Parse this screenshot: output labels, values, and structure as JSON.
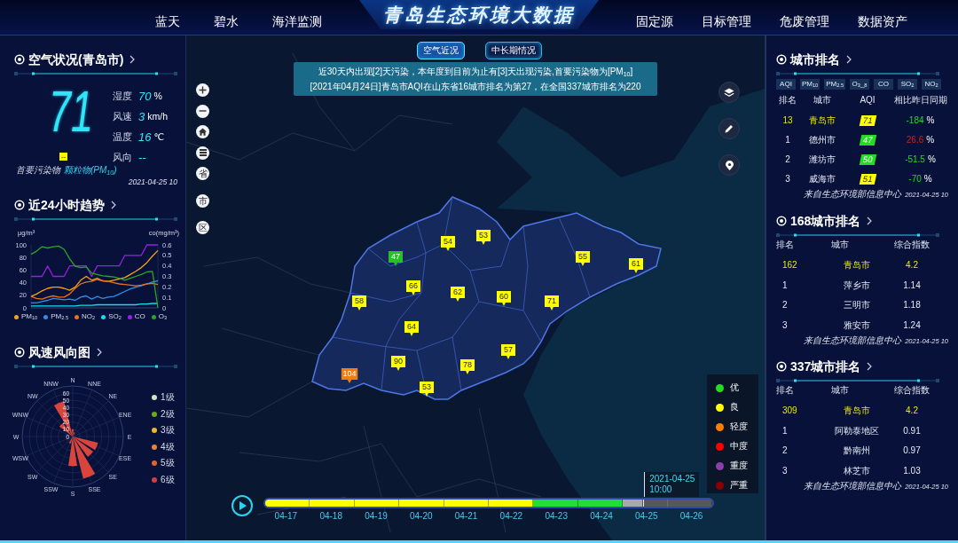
{
  "header": {
    "nav_left": [
      "蓝天",
      "碧水",
      "海洋监测"
    ],
    "title": "青岛生态环境大数据",
    "nav_right": [
      "固定源",
      "目标管理",
      "危废管理",
      "数据资产"
    ]
  },
  "air_status": {
    "title": "空气状况(青岛市)",
    "aqi": "71",
    "weather": [
      {
        "label": "湿度",
        "value": "70",
        "unit": "%"
      },
      {
        "label": "风速",
        "value": "3",
        "unit": "km/h"
      },
      {
        "label": "温度",
        "value": "16",
        "unit": "℃"
      }
    ],
    "wind_direction": {
      "label": "风向",
      "value": "--"
    },
    "pollutant_badge": "--",
    "pollutant_label": "首要污染物",
    "pollutant_value": "颗粒物(PM$_{10}$)",
    "time": "2021-04-25 10"
  },
  "trend": {
    "title": "近24小时趋势",
    "chart_data": {
      "type": "line",
      "ylabel": "μg/m³",
      "ylim": [
        0,
        100
      ],
      "yticks": [
        0,
        20,
        40,
        60,
        80,
        100
      ],
      "y2label": "co(mg/m³)",
      "y2lim": [
        0,
        0.6
      ],
      "y2ticks": [
        0,
        0.1,
        0.2,
        0.3,
        0.4,
        0.5,
        0.6
      ],
      "series": [
        {
          "name": "PM$_{10}$",
          "color": "#f2a51a",
          "values": [
            18,
            22,
            27,
            31,
            33,
            33,
            31,
            28,
            33,
            44,
            50,
            44,
            47,
            43,
            42,
            44,
            46,
            48,
            53,
            58,
            64,
            72,
            82,
            91
          ]
        },
        {
          "name": "PM$_{2.5}$",
          "color": "#2f8fe6",
          "values": [
            8,
            8,
            10,
            12,
            15,
            14,
            13,
            14,
            12,
            17,
            19,
            14,
            18,
            15,
            17,
            18,
            22,
            26,
            30,
            33,
            35,
            38,
            41,
            43
          ]
        },
        {
          "name": "NO$_{2}$",
          "color": "#e8711c",
          "values": [
            18,
            15,
            14,
            17,
            19,
            17,
            17,
            22,
            31,
            38,
            41,
            42,
            45,
            43,
            42,
            40,
            38,
            37,
            36,
            35,
            36,
            38,
            39,
            37
          ]
        },
        {
          "name": "SO$_{2}$",
          "color": "#10e0f0",
          "values": [
            3,
            3,
            3,
            3,
            3,
            3,
            3,
            3,
            3,
            4,
            4,
            4,
            5,
            5,
            5,
            5,
            5,
            5,
            5,
            5,
            6,
            6,
            7,
            7
          ]
        },
        {
          "name": "CO",
          "color": "#9b1de8",
          "axis": "y2",
          "values": [
            0.3,
            0.3,
            0.3,
            0.4,
            0.3,
            0.3,
            0.3,
            0.4,
            0.4,
            0.4,
            0.4,
            0.3,
            0.4,
            0.4,
            0.4,
            0.4,
            0.4,
            0.5,
            0.5,
            0.5,
            0.5,
            0.6,
            0.6,
            0.6
          ]
        },
        {
          "name": "O$_{3}$",
          "color": "#2aa52a",
          "values": [
            85,
            90,
            97,
            95,
            97,
            98,
            93,
            78,
            66,
            64,
            65,
            55,
            53,
            51,
            50,
            49,
            47,
            44,
            47,
            50,
            53,
            57,
            58,
            0
          ]
        }
      ]
    }
  },
  "wind": {
    "title": "风速风向图",
    "directions": [
      "N",
      "NNW",
      "NNE",
      "NW",
      "NE",
      "WNW",
      "ENE",
      "W",
      "E",
      "WSW",
      "ESE",
      "SW",
      "SE",
      "SSW",
      "SSE",
      "S"
    ],
    "radial_ticks": [
      "60",
      "50",
      "40",
      "30",
      "20",
      "10",
      "0"
    ],
    "legend": [
      {
        "label": "1级",
        "color": "#c5e8c0"
      },
      {
        "label": "2级",
        "color": "#6fa81a"
      },
      {
        "label": "3级",
        "color": "#f0b429"
      },
      {
        "label": "4级",
        "color": "#e8843a"
      },
      {
        "label": "5级",
        "color": "#e5622b"
      },
      {
        "label": "6级",
        "color": "#d13f3f"
      }
    ]
  },
  "map": {
    "tabs": [
      {
        "label": "空气近况",
        "selected": true
      },
      {
        "label": "中长期情况",
        "selected": false
      }
    ],
    "notice": [
      "近30天内出现[2]天污染，本年度到目前为止有[3]天出现污染,首要污染物为[PM$_{10}$]",
      "[2021年04月24日]青岛市AQI在山东省16城市排名为第27，在全国337城市排名为220"
    ],
    "region_buttons": [
      "省",
      "市",
      "区"
    ],
    "markers": [
      {
        "value": "53",
        "color": "#ffff00"
      },
      {
        "value": "54",
        "color": "#ffff00"
      },
      {
        "value": "47",
        "color": "#22c322"
      },
      {
        "value": "55",
        "color": "#ffff00"
      },
      {
        "value": "61",
        "color": "#ffff00"
      },
      {
        "value": "66",
        "color": "#ffff00"
      },
      {
        "value": "62",
        "color": "#ffff00"
      },
      {
        "value": "60",
        "color": "#ffff00"
      },
      {
        "value": "58",
        "color": "#ffff00"
      },
      {
        "value": "71",
        "color": "#ffff00"
      },
      {
        "value": "64",
        "color": "#ffff00"
      },
      {
        "value": "57",
        "color": "#ffff00"
      },
      {
        "value": "90",
        "color": "#ffff00"
      },
      {
        "value": "78",
        "color": "#ffff00"
      },
      {
        "value": "104",
        "color": "#f07c14"
      },
      {
        "value": "53",
        "color": "#ffff00"
      }
    ],
    "legend": [
      {
        "label": "优",
        "color": "#22dd22"
      },
      {
        "label": "良",
        "color": "#ffff00"
      },
      {
        "label": "轻度",
        "color": "#ff7e00"
      },
      {
        "label": "中度",
        "color": "#ff0000"
      },
      {
        "label": "重度",
        "color": "#8b3fa8"
      },
      {
        "label": "严重",
        "color": "#8b0000"
      }
    ],
    "timeline": {
      "days": [
        {
          "label": "04-17",
          "color": "#ffff00"
        },
        {
          "label": "04-18",
          "color": "#ffff00"
        },
        {
          "label": "04-19",
          "color": "#ffff00"
        },
        {
          "label": "04-20",
          "color": "#ffff00"
        },
        {
          "label": "04-21",
          "color": "#ffff00"
        },
        {
          "label": "04-22",
          "color": "#ffff00"
        },
        {
          "label": "04-23",
          "color": "#22dd33"
        },
        {
          "label": "04-24",
          "color": "#22dd33"
        },
        {
          "label": "04-25",
          "color": "#a8a8a8"
        },
        {
          "label": "04-26",
          "color": "#585858"
        }
      ],
      "level": 0.845,
      "tooltip": [
        "2021-04-25",
        "10:00"
      ]
    }
  },
  "city_ranking": {
    "title": "城市排名",
    "tabs": [
      "AQI",
      "PM$_{10}$",
      "PM$_{2.5}$",
      "O$_{3}$_$_{8}$",
      "CO",
      "SO$_{2}$",
      "NO$_{2}$"
    ],
    "columns": [
      "排名",
      "城市",
      "AQI",
      "相比昨日同期"
    ],
    "rows": [
      {
        "rank": "13",
        "city": "青岛市",
        "aqi": "71",
        "color": "#ffff00",
        "change": "-184",
        "unit": "%",
        "up": false,
        "highlight": true
      },
      {
        "rank": "1",
        "city": "德州市",
        "aqi": "47",
        "color": "#22dd22",
        "change": "26.6",
        "unit": "%",
        "up": true,
        "highlight": false
      },
      {
        "rank": "2",
        "city": "潍坊市",
        "aqi": "50",
        "color": "#22dd22",
        "change": "-51.5",
        "unit": "%",
        "up": false,
        "highlight": false
      },
      {
        "rank": "3",
        "city": "威海市",
        "aqi": "51",
        "color": "#ffff00",
        "change": "-70",
        "unit": "%",
        "up": false,
        "highlight": false
      }
    ],
    "source": "来自生态环境部信息中心",
    "time": "2021-04-25 10"
  },
  "ranking_168": {
    "title": "168城市排名",
    "columns": [
      "排名",
      "城市",
      "综合指数"
    ],
    "rows": [
      {
        "rank": "162",
        "city": "青岛市",
        "index": "4.2",
        "highlight": true
      },
      {
        "rank": "1",
        "city": "萍乡市",
        "index": "1.14",
        "highlight": false
      },
      {
        "rank": "2",
        "city": "三明市",
        "index": "1.18",
        "highlight": false
      },
      {
        "rank": "3",
        "city": "雅安市",
        "index": "1.24",
        "highlight": false
      }
    ],
    "source": "来自生态环境部信息中心",
    "time": "2021-04-25 10"
  },
  "ranking_337": {
    "title": "337城市排名",
    "columns": [
      "排名",
      "城市",
      "综合指数"
    ],
    "rows": [
      {
        "rank": "309",
        "city": "青岛市",
        "index": "4.2",
        "highlight": true
      },
      {
        "rank": "1",
        "city": "阿勒泰地区",
        "index": "0.91",
        "highlight": false
      },
      {
        "rank": "2",
        "city": "黔南州",
        "index": "0.97",
        "highlight": false
      },
      {
        "rank": "3",
        "city": "林芝市",
        "index": "1.03",
        "highlight": false
      }
    ],
    "source": "来自生态环境部信息中心",
    "time": "2021-04-25 10"
  }
}
